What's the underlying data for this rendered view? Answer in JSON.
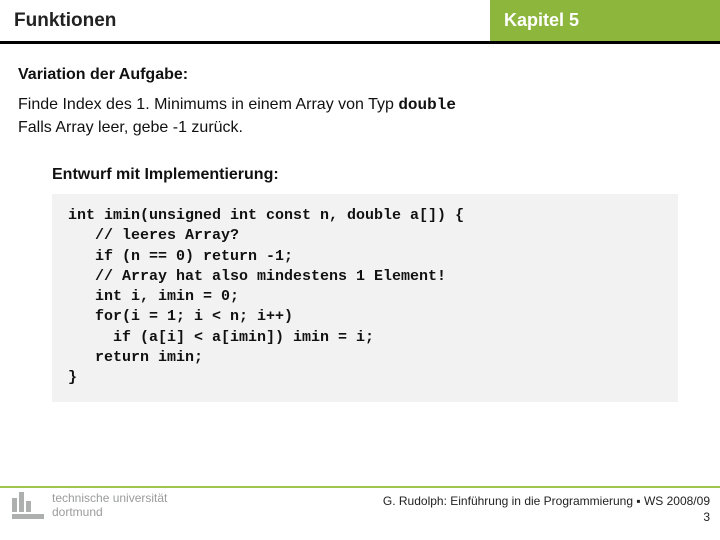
{
  "header": {
    "left": "Funktionen",
    "right": "Kapitel 5"
  },
  "section": {
    "subheading": "Variation der Aufgabe:",
    "task_line1_pre": "Finde Index des 1. Minimums in einem Array von Typ ",
    "task_line1_mono": "double",
    "task_line2": "Falls Array leer, gebe -1 zurück."
  },
  "impl": {
    "heading": "Entwurf mit Implementierung:",
    "code": "int imin(unsigned int const n, double a[]) {\n   // leeres Array?\n   if (n == 0) return -1;\n   // Array hat also mindestens 1 Element!\n   int i, imin = 0;\n   for(i = 1; i < n; i++)\n     if (a[i] < a[imin]) imin = i;\n   return imin;\n}"
  },
  "footer": {
    "uni_line1": "technische universität",
    "uni_line2": "dortmund",
    "credit": "G. Rudolph: Einführung in die Programmierung ▪ WS 2008/09",
    "page": "3"
  }
}
